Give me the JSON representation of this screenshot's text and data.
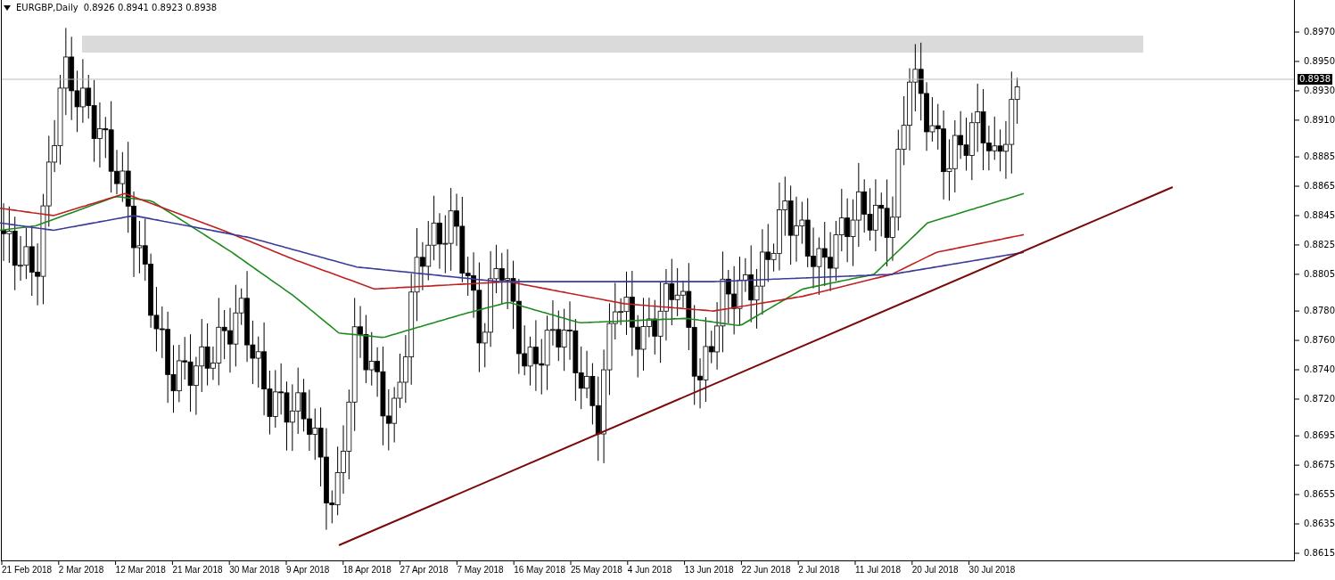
{
  "header": {
    "symbol": "EURGBP,Daily",
    "ohlc": "0.8926 0.8941 0.8923 0.8938"
  },
  "price_axis": {
    "labels": [
      "0.8970",
      "0.8950",
      "0.8930",
      "0.8910",
      "0.8885",
      "0.8865",
      "0.8845",
      "0.8825",
      "0.8805",
      "0.8780",
      "0.8760",
      "0.8740",
      "0.8720",
      "0.8695",
      "0.8675",
      "0.8655",
      "0.8635",
      "0.8615"
    ],
    "current_price": "0.8938"
  },
  "time_axis": {
    "labels": [
      "21 Feb 2018",
      "2 Mar 2018",
      "12 Mar 2018",
      "21 Mar 2018",
      "30 Mar 2018",
      "9 Apr 2018",
      "18 Apr 2018",
      "27 Apr 2018",
      "7 May 2018",
      "16 May 2018",
      "25 May 2018",
      "4 Jun 2018",
      "13 Jun 2018",
      "22 Jun 2018",
      "2 Jul 2018",
      "11 Jul 2018",
      "20 Jul 2018",
      "30 Jul 2018"
    ]
  }
}
